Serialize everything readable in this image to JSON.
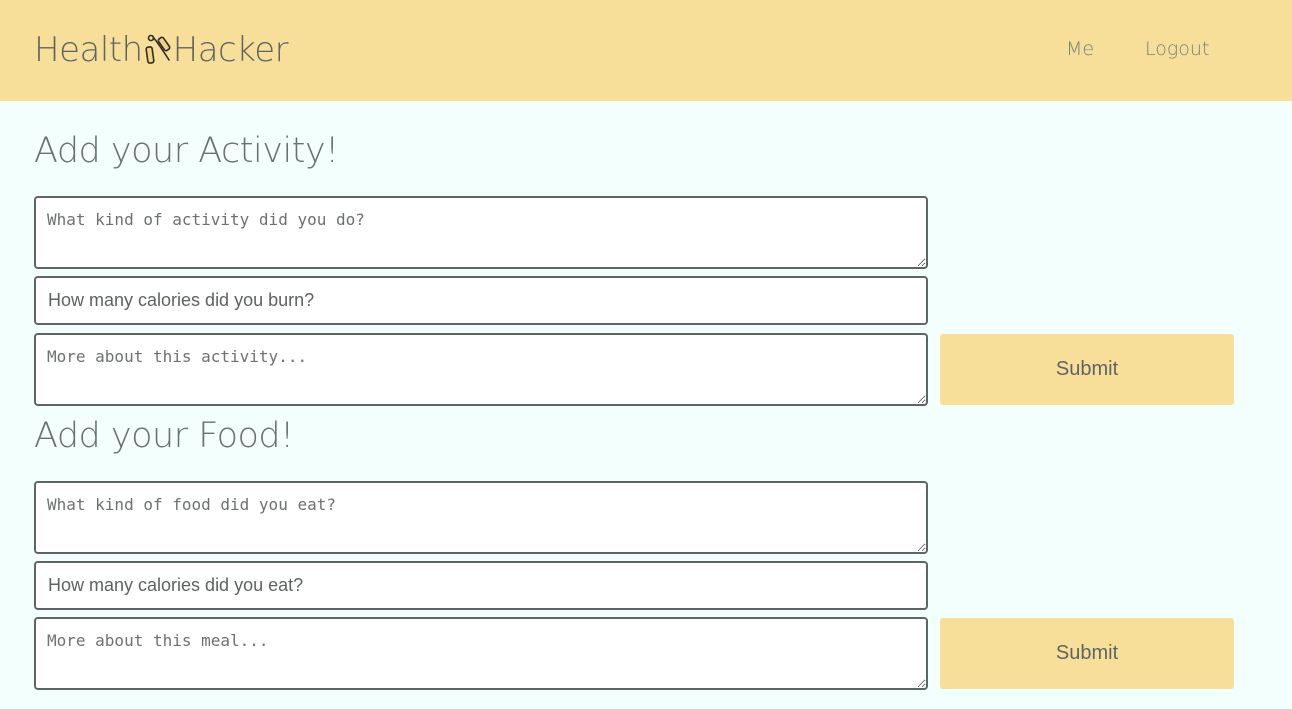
{
  "header": {
    "brand_left": "Health",
    "brand_right": "Hacker",
    "brand_icon": "jump-rope-icon",
    "nav": {
      "me": "Me",
      "logout": "Logout"
    },
    "background_color": "#f7df99"
  },
  "activity": {
    "title": "Add your Activity!",
    "kind_placeholder": "What kind of activity did you do?",
    "calories_placeholder": "How many calories did you burn?",
    "details_placeholder": "More about this activity...",
    "submit_label": "Submit"
  },
  "food": {
    "title": "Add your Food!",
    "kind_placeholder": "What kind of food did you eat?",
    "calories_placeholder": "How many calories did you eat?",
    "details_placeholder": "More about this meal...",
    "submit_label": "Submit"
  },
  "colors": {
    "accent": "#f7df99",
    "page_background": "#f3fffd",
    "field_border": "#5e6565"
  }
}
